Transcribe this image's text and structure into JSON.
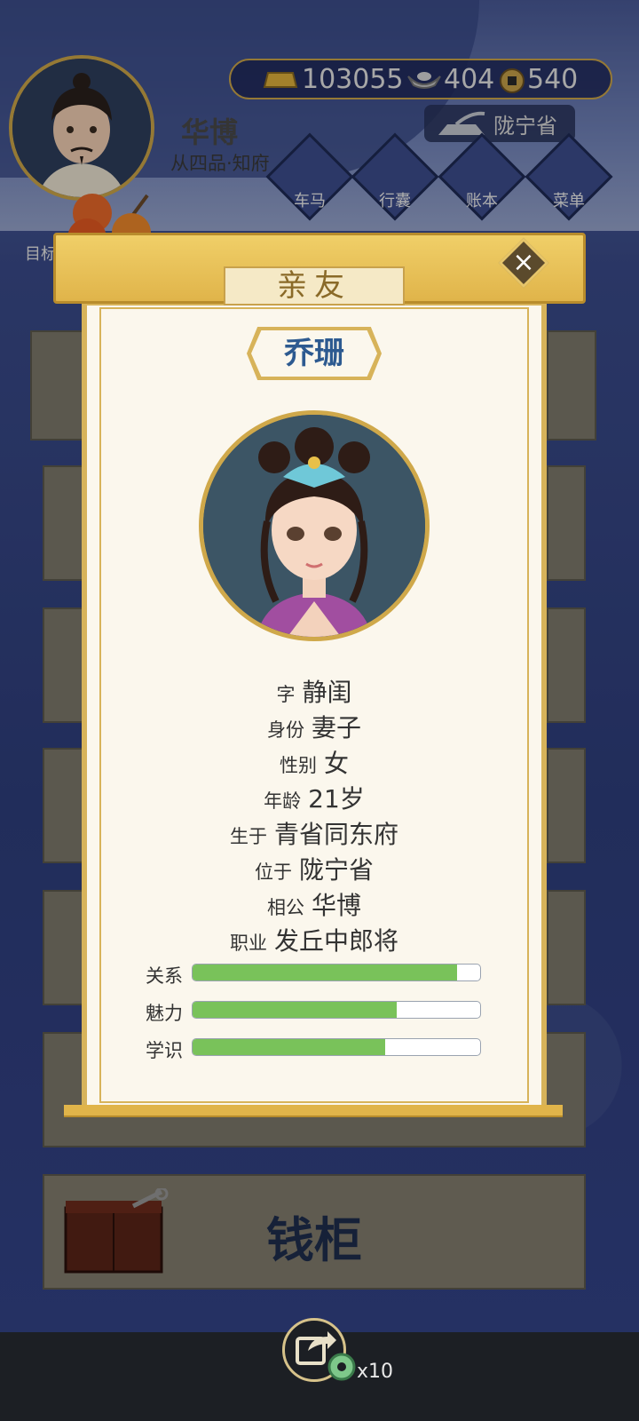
{
  "player": {
    "name": "华博",
    "rank": "从四品·知府"
  },
  "resources": {
    "gold": "103055",
    "silver": "404",
    "coins": "540"
  },
  "location": "陇宁省",
  "menu": {
    "carriage": "车马",
    "luggage": "行囊",
    "ledger": "账本",
    "menu": "菜单"
  },
  "goal_label": "目标",
  "modal": {
    "title": "亲友",
    "name": "乔珊",
    "info": [
      {
        "key": "字",
        "value": "静闺"
      },
      {
        "key": "身份",
        "value": "妻子"
      },
      {
        "key": "性别",
        "value": "女"
      },
      {
        "key": "年龄",
        "value": "21岁"
      },
      {
        "key": "生于",
        "value": "青省同东府"
      },
      {
        "key": "位于",
        "value": "陇宁省"
      },
      {
        "key": "相公",
        "value": "华博"
      },
      {
        "key": "职业",
        "value": "发丘中郎将"
      }
    ],
    "stats": [
      {
        "label": "关系",
        "value": 0.92
      },
      {
        "label": "魅力",
        "value": 0.71
      },
      {
        "label": "学识",
        "value": 0.67
      }
    ]
  },
  "chest_label": "钱柜",
  "share": {
    "count_text": "x10"
  },
  "colors": {
    "accent_gold": "#d7b35a",
    "name_blue": "#2d5a90",
    "bar_green": "#79c25a"
  }
}
